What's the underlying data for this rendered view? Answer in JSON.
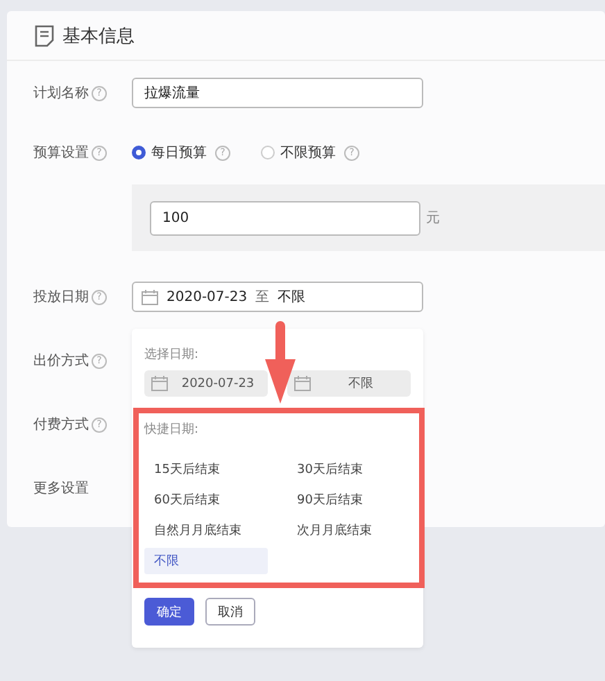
{
  "section": {
    "title": "基本信息"
  },
  "plan_name": {
    "label": "计划名称",
    "help": "?",
    "value": "拉爆流量"
  },
  "budget": {
    "label": "预算设置",
    "help": "?",
    "options": [
      {
        "label": "每日预算",
        "help": "?",
        "selected": true
      },
      {
        "label": "不限预算",
        "help": "?",
        "selected": false
      }
    ],
    "amount": "100",
    "unit": "元"
  },
  "schedule": {
    "label": "投放日期",
    "help": "?",
    "start": "2020-07-23",
    "separator": "至",
    "end": "不限"
  },
  "other_rows": [
    {
      "label": "出价方式",
      "help": "?"
    },
    {
      "label": "付费方式",
      "help": "?"
    },
    {
      "label": "更多设置"
    }
  ],
  "date_popup": {
    "pick_label": "选择日期:",
    "start": "2020-07-23",
    "end": "不限",
    "quick_label": "快捷日期:",
    "quick_options": [
      {
        "label": "15天后结束",
        "selected": false
      },
      {
        "label": "30天后结束",
        "selected": false
      },
      {
        "label": "60天后结束",
        "selected": false
      },
      {
        "label": "90天后结束",
        "selected": false
      },
      {
        "label": "自然月月底结束",
        "selected": false
      },
      {
        "label": "次月月底结束",
        "selected": false
      },
      {
        "label": "不限",
        "selected": true
      }
    ],
    "buttons": [
      {
        "label": "确定",
        "kind": "primary"
      },
      {
        "label": "取消",
        "kind": "default"
      }
    ]
  }
}
